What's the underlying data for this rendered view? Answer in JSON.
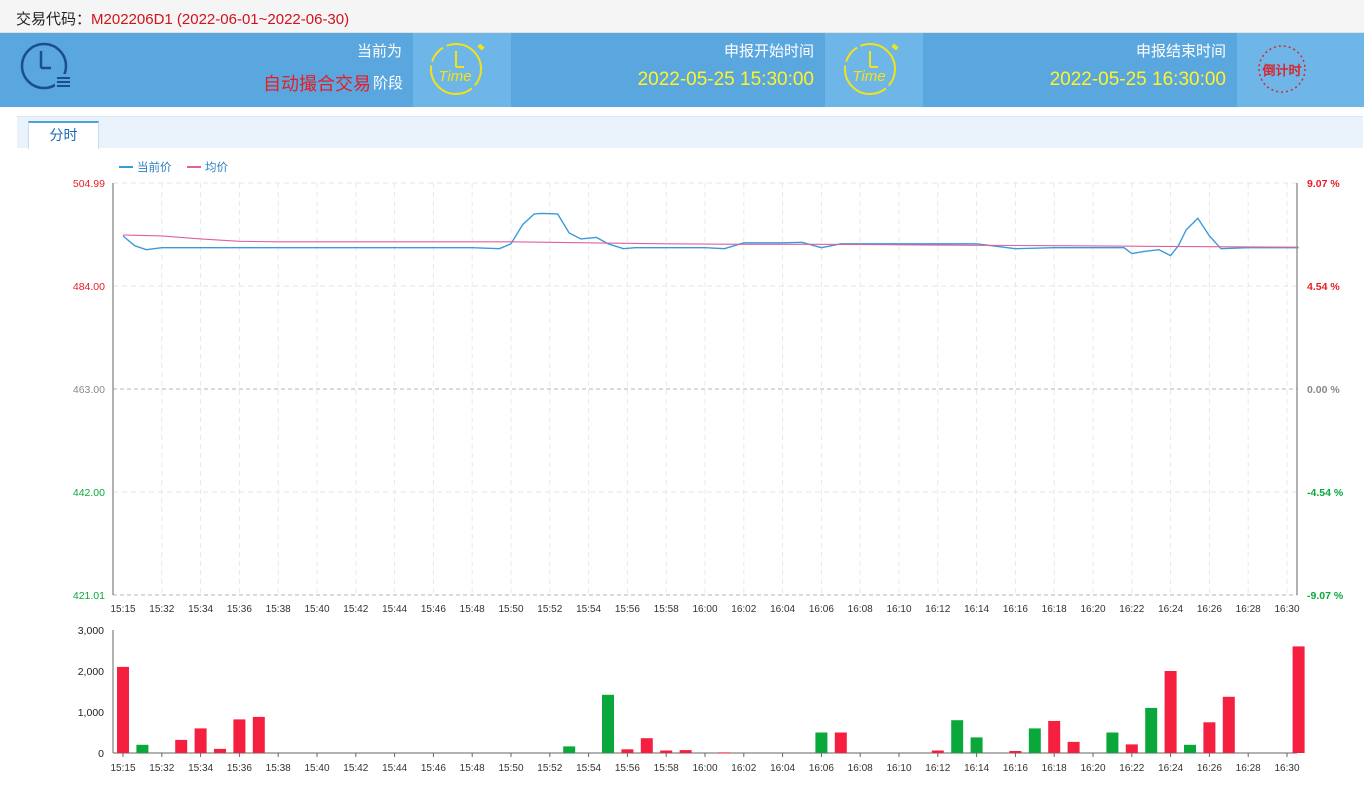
{
  "header": {
    "code_label": "交易代码：",
    "code_value": "M202206D1 (2022-06-01~2022-06-30)"
  },
  "banner": {
    "phase_title": "当前为",
    "phase_value": "自动撮合交易",
    "phase_suffix": "阶段",
    "start_title": "申报开始时间",
    "start_value": "2022-05-25 15:30:00",
    "end_title": "申报结束时间",
    "end_value": "2022-05-25 16:30:00",
    "clock_icon": "clock-list-icon",
    "time_icon_text": "Time",
    "countdown_icon_text": "倒计时",
    "colors": {
      "bg": "#5aa7df",
      "highlight": "#fff32a",
      "phase": "#e41e26"
    }
  },
  "tabs": [
    {
      "label": "分时",
      "active": true
    }
  ],
  "chart_data": [
    {
      "type": "line",
      "legend": [
        "当前价",
        "均价"
      ],
      "legend_position": "top-left",
      "y_left_ticks": [
        "504.99",
        "484.00",
        "463.00",
        "442.00",
        "421.01"
      ],
      "y_right_ticks": [
        "9.07 %",
        "4.54 %",
        "0.00 %",
        "-4.54 %",
        "-9.07 %"
      ],
      "ylim": [
        421.01,
        504.99
      ],
      "base_price": 463.0,
      "x_ticks": [
        "15:15",
        "15:32",
        "15:34",
        "15:36",
        "15:38",
        "15:40",
        "15:42",
        "15:44",
        "15:46",
        "15:48",
        "15:50",
        "15:52",
        "15:54",
        "15:56",
        "15:58",
        "16:00",
        "16:02",
        "16:04",
        "16:06",
        "16:08",
        "16:10",
        "16:12",
        "16:14",
        "16:16",
        "16:18",
        "16:20",
        "16:22",
        "16:24",
        "16:26",
        "16:28",
        "16:30"
      ],
      "series": [
        {
          "name": "当前价",
          "color": "#3b9bd9",
          "x": [
            0,
            0.3,
            0.6,
            1,
            2,
            3,
            4,
            5,
            6,
            7,
            8,
            9,
            9.7,
            10,
            10.3,
            10.6,
            10.8,
            11.2,
            11.5,
            11.8,
            12.2,
            12.5,
            12.9,
            13.2,
            13.5,
            14,
            15,
            15.5,
            16,
            17,
            17.5,
            18,
            18.5,
            19,
            20,
            21,
            22,
            23,
            24,
            24.5,
            25,
            25.5,
            25.8,
            26,
            26.3,
            26.7,
            27,
            27.2,
            27.4,
            27.7,
            28,
            28.3,
            29,
            30.3
          ],
          "values": [
            494.2,
            492.2,
            491.4,
            491.8,
            491.8,
            491.8,
            491.8,
            491.8,
            491.8,
            491.8,
            491.8,
            491.8,
            491.6,
            492.6,
            496.5,
            498.7,
            498.8,
            498.7,
            494.8,
            493.6,
            493.9,
            492.6,
            491.6,
            491.8,
            491.8,
            491.8,
            491.8,
            491.6,
            492.8,
            492.8,
            492.9,
            491.8,
            492.6,
            492.6,
            492.6,
            492.6,
            492.6,
            491.6,
            491.8,
            491.8,
            491.8,
            491.8,
            491.8,
            490.6,
            491.0,
            491.4,
            490.2,
            492.2,
            495.4,
            497.8,
            494.2,
            491.6,
            491.8,
            491.8
          ]
        },
        {
          "name": "均价",
          "color": "#e0609e",
          "x": [
            0,
            1,
            2,
            3,
            4,
            5,
            6,
            8,
            10,
            12,
            14,
            16,
            18,
            20,
            22,
            24,
            26,
            28,
            30.3
          ],
          "values": [
            494.4,
            494.2,
            493.6,
            493.1,
            493.0,
            493.0,
            493.0,
            493.0,
            493.0,
            492.8,
            492.6,
            492.5,
            492.5,
            492.4,
            492.3,
            492.2,
            492.1,
            492.0,
            491.9
          ]
        }
      ]
    },
    {
      "type": "bar",
      "y_ticks": [
        "3,000",
        "2,000",
        "1,000",
        "0"
      ],
      "ylim": [
        0,
        3000
      ],
      "x_ticks": [
        "15:15",
        "15:32",
        "15:34",
        "15:36",
        "15:38",
        "15:40",
        "15:42",
        "15:44",
        "15:46",
        "15:48",
        "15:50",
        "15:52",
        "15:54",
        "15:56",
        "15:58",
        "16:00",
        "16:02",
        "16:04",
        "16:06",
        "16:08",
        "16:10",
        "16:12",
        "16:14",
        "16:16",
        "16:18",
        "16:20",
        "16:22",
        "16:24",
        "16:26",
        "16:28",
        "16:30"
      ],
      "bars": [
        {
          "x": 0,
          "value": 2100,
          "dir": "up"
        },
        {
          "x": 0.5,
          "value": 200,
          "dir": "down"
        },
        {
          "x": 1.5,
          "value": 320,
          "dir": "up"
        },
        {
          "x": 2,
          "value": 600,
          "dir": "up"
        },
        {
          "x": 2.5,
          "value": 100,
          "dir": "up"
        },
        {
          "x": 3,
          "value": 820,
          "dir": "up"
        },
        {
          "x": 3.5,
          "value": 880,
          "dir": "up"
        },
        {
          "x": 11.5,
          "value": 160,
          "dir": "down"
        },
        {
          "x": 12.5,
          "value": 1420,
          "dir": "down"
        },
        {
          "x": 13,
          "value": 90,
          "dir": "up"
        },
        {
          "x": 13.5,
          "value": 360,
          "dir": "up"
        },
        {
          "x": 14,
          "value": 60,
          "dir": "up"
        },
        {
          "x": 14.5,
          "value": 70,
          "dir": "up"
        },
        {
          "x": 15.5,
          "value": 15,
          "dir": "up"
        },
        {
          "x": 18,
          "value": 500,
          "dir": "down"
        },
        {
          "x": 18.5,
          "value": 500,
          "dir": "up"
        },
        {
          "x": 21,
          "value": 60,
          "dir": "up"
        },
        {
          "x": 21.5,
          "value": 800,
          "dir": "down"
        },
        {
          "x": 22,
          "value": 380,
          "dir": "down"
        },
        {
          "x": 23,
          "value": 50,
          "dir": "up"
        },
        {
          "x": 23.5,
          "value": 600,
          "dir": "down"
        },
        {
          "x": 24,
          "value": 780,
          "dir": "up"
        },
        {
          "x": 24.5,
          "value": 270,
          "dir": "up"
        },
        {
          "x": 25.5,
          "value": 500,
          "dir": "down"
        },
        {
          "x": 26,
          "value": 210,
          "dir": "up"
        },
        {
          "x": 26.5,
          "value": 1100,
          "dir": "down"
        },
        {
          "x": 27,
          "value": 2000,
          "dir": "up"
        },
        {
          "x": 27.5,
          "value": 200,
          "dir": "down"
        },
        {
          "x": 28,
          "value": 750,
          "dir": "up"
        },
        {
          "x": 28.5,
          "value": 1370,
          "dir": "up"
        },
        {
          "x": 30.3,
          "value": 2600,
          "dir": "up"
        }
      ],
      "colors": {
        "up": "#f5203f",
        "down": "#0aa83a"
      }
    }
  ]
}
